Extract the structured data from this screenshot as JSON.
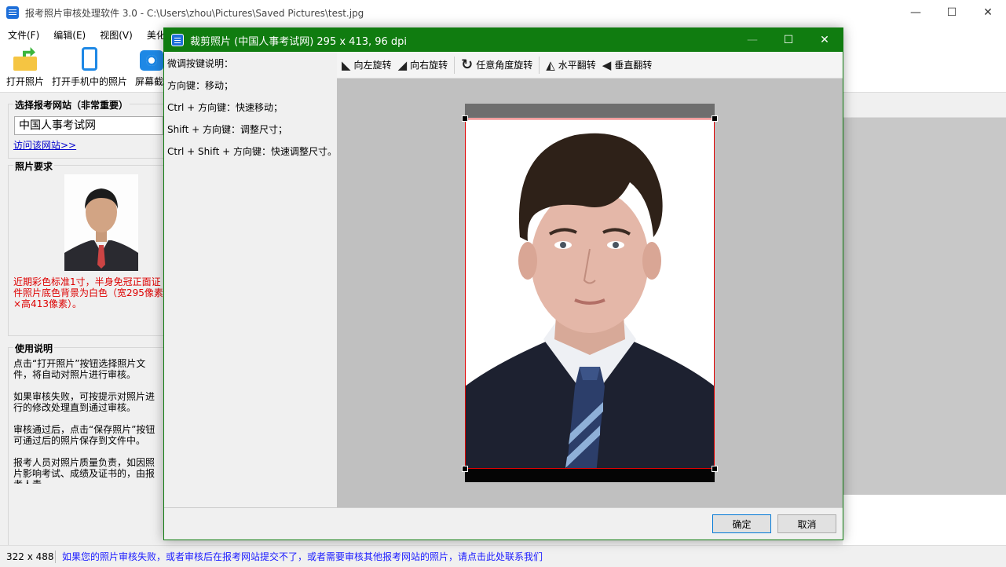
{
  "main_window": {
    "title": "报考照片审核处理软件 3.0 - C:\\Users\\zhou\\Pictures\\Saved Pictures\\test.jpg",
    "controls": {
      "minimize": "—",
      "maximize": "☐",
      "close": "✕"
    }
  },
  "menu": [
    "文件(F)",
    "编辑(E)",
    "视图(V)",
    "美化(B"
  ],
  "toolbar": {
    "open_photo": "打开照片",
    "open_phone_photo": "打开手机中的照片",
    "screenshot": "屏幕截"
  },
  "left_panel": {
    "site_title": "选择报考网站（非常重要）",
    "site_value": "中国人事考试网",
    "visit_link": "访问该网站>>",
    "req_title": "照片要求",
    "req_text": "近期彩色标准1寸，半身免冠正面证件照片底色背景为白色（宽295像素×高413像素）。",
    "usage_title": "使用说明",
    "usage_text": "点击“打开照片”按钮选择照片文件，将自动对照片进行审核。\n\n如果审核失败，可按提示对照片进行的修改处理直到通过审核。\n\n审核通过后，点击“保存照片”按钮可通过后的照片保存到文件中。\n\n报考人员对照片质量负责，如因照片影响考试、成绩及证书的，由报考人责。"
  },
  "status": {
    "size": "322 x 488",
    "message": "如果您的照片审核失败，或者审核后在报考网站提交不了，或者需要审核其他报考网站的照片，请点击此处联系我们"
  },
  "dialog": {
    "title": "裁剪照片 (中国人事考试网) 295 x 413, 96 dpi",
    "controls": {
      "minimize": "—",
      "maximize": "☐",
      "close": "✕"
    },
    "help_lines": [
      "微调按键说明：",
      "方向键：移动；",
      "Ctrl + 方向键：快速移动；",
      "Shift + 方向键：调整尺寸；",
      "Ctrl + Shift + 方向键：快速调整尺寸。"
    ],
    "toolbar": {
      "rotate_left": "向左旋转",
      "rotate_right": "向右旋转",
      "rotate_any": "任意角度旋转",
      "flip_h": "水平翻转",
      "flip_v": "垂直翻转"
    },
    "ok": "确定",
    "cancel": "取消"
  },
  "colors": {
    "dialog_titlebar": "#107c10",
    "crop_border": "#e00000",
    "link": "#0000cc",
    "requirement_text": "#dd0000",
    "canvas_bg": "#c0c0c0"
  }
}
